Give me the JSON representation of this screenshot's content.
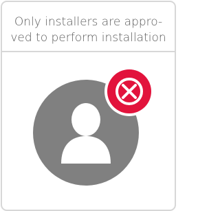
{
  "notice": {
    "line1": "Only installers are appro-",
    "line2": "ved to perform installation"
  },
  "icons": {
    "person": "user-silhouette-icon",
    "status": "not-allowed-x-icon"
  },
  "colors": {
    "border": "#d7d7d7",
    "avatar_circle": "#808080",
    "status_red": "#e2133c",
    "text": "#5b5b5b"
  }
}
